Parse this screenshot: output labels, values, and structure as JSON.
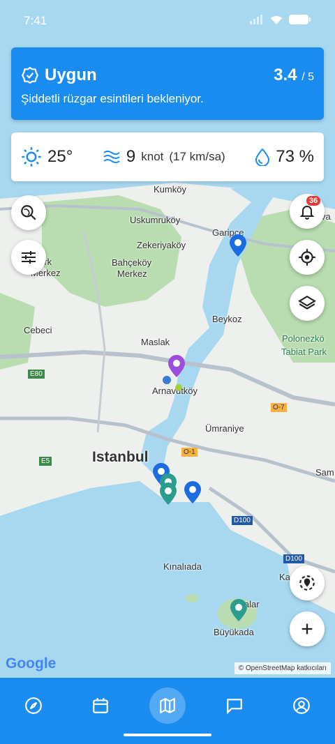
{
  "status_bar": {
    "time": "7:41"
  },
  "condition_card": {
    "title": "Uygun",
    "score": "3.4",
    "score_max": "/ 5",
    "description": "Şiddetli rüzgar esintileri bekleniyor.",
    "color": "#1a8cf0"
  },
  "weather": {
    "temperature": "25°",
    "wind_value": "9",
    "wind_unit": "knot",
    "wind_alt": "(17 km/sa)",
    "humidity": "73 %"
  },
  "map_controls": {
    "notifications_count": "36"
  },
  "map_labels": {
    "kumkoy": "Kumköy",
    "uskumruköy": "Uskumruköy",
    "garipce": "Garipce",
    "zekeriyakoy": "Zekeriyaköy",
    "bahcekoy": "Bahçeköy",
    "merkez": "Merkez",
    "turk": "ktürk",
    "merkez2": "Merkez",
    "beykoz": "Beykoz",
    "cebeci": "Cebeci",
    "maslak": "Maslak",
    "polonezkoy": "Polonezkö",
    "tabiat_park": "Tabiat Park",
    "arnavutkoy": "Arnavutköy",
    "umraniye": "Ümraniye",
    "istanbul": "Istanbul",
    "sam": "Sam",
    "kinaliada": "Kınalıada",
    "adalar": "Adalar",
    "buyukada": "Büyükada",
    "road_e80": "E80",
    "road_e5": "E5",
    "road_o1": "O-1",
    "road_o7": "O-7",
    "road_d100a": "D100",
    "road_d100b": "D100",
    "va": "va",
    "ka": "Ka"
  },
  "map_footer": {
    "google": "Google",
    "attribution": "© OpenStreetMap katkıcıları"
  },
  "nav": {
    "items": [
      "compass-icon",
      "calendar-icon",
      "map-icon",
      "chat-icon",
      "profile-icon"
    ],
    "active_index": 2
  }
}
